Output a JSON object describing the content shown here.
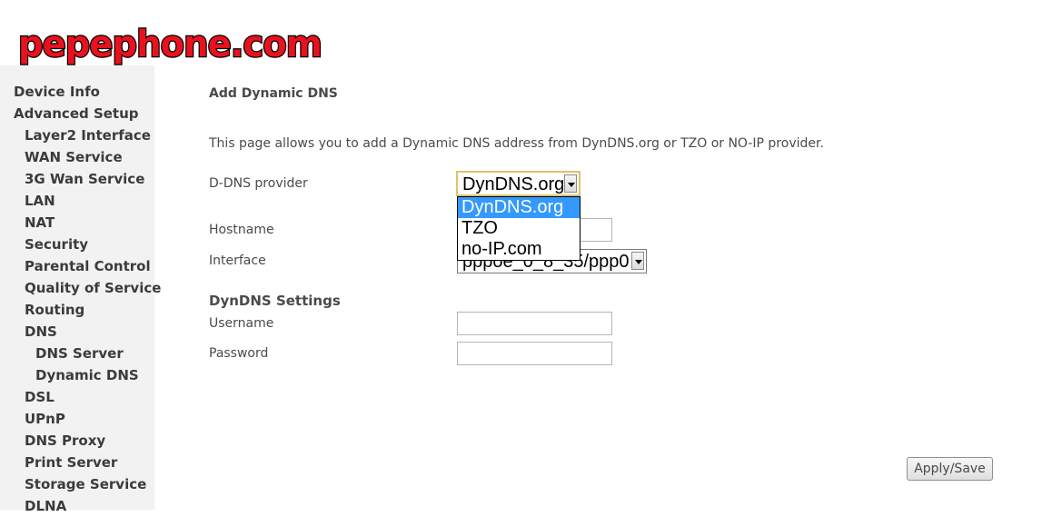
{
  "logo": {
    "text": "pepephone.com",
    "color": "#e8121e"
  },
  "sidebar": {
    "items": [
      {
        "label": "Device Info",
        "level": 0
      },
      {
        "label": "Advanced Setup",
        "level": 0
      },
      {
        "label": "Layer2 Interface",
        "level": 1
      },
      {
        "label": "WAN Service",
        "level": 1
      },
      {
        "label": "3G Wan Service",
        "level": 1
      },
      {
        "label": "LAN",
        "level": 1
      },
      {
        "label": "NAT",
        "level": 1
      },
      {
        "label": "Security",
        "level": 1
      },
      {
        "label": "Parental Control",
        "level": 1
      },
      {
        "label": "Quality of Service",
        "level": 1
      },
      {
        "label": "Routing",
        "level": 1
      },
      {
        "label": "DNS",
        "level": 1
      },
      {
        "label": "DNS Server",
        "level": 2
      },
      {
        "label": "Dynamic DNS",
        "level": 2
      },
      {
        "label": "DSL",
        "level": 1
      },
      {
        "label": "UPnP",
        "level": 1
      },
      {
        "label": "DNS Proxy",
        "level": 1
      },
      {
        "label": "Print Server",
        "level": 1
      },
      {
        "label": "Storage Service",
        "level": 1
      },
      {
        "label": "DLNA",
        "level": 1
      }
    ]
  },
  "main": {
    "title": "Add Dynamic DNS",
    "description": "This page allows you to add a Dynamic DNS address from DynDNS.org or TZO or NO-IP provider.",
    "provider": {
      "label": "D-DNS provider",
      "value": "DynDNS.org",
      "options": [
        "DynDNS.org",
        "TZO",
        "no-IP.com"
      ],
      "highlighted": "DynDNS.org"
    },
    "hostname": {
      "label": "Hostname",
      "value": ""
    },
    "interface": {
      "label": "Interface",
      "value": "pppoe_0_8_35/ppp0"
    },
    "settings": {
      "title": "DynDNS Settings",
      "username": {
        "label": "Username",
        "value": ""
      },
      "password": {
        "label": "Password",
        "value": ""
      }
    },
    "apply_label": "Apply/Save"
  }
}
